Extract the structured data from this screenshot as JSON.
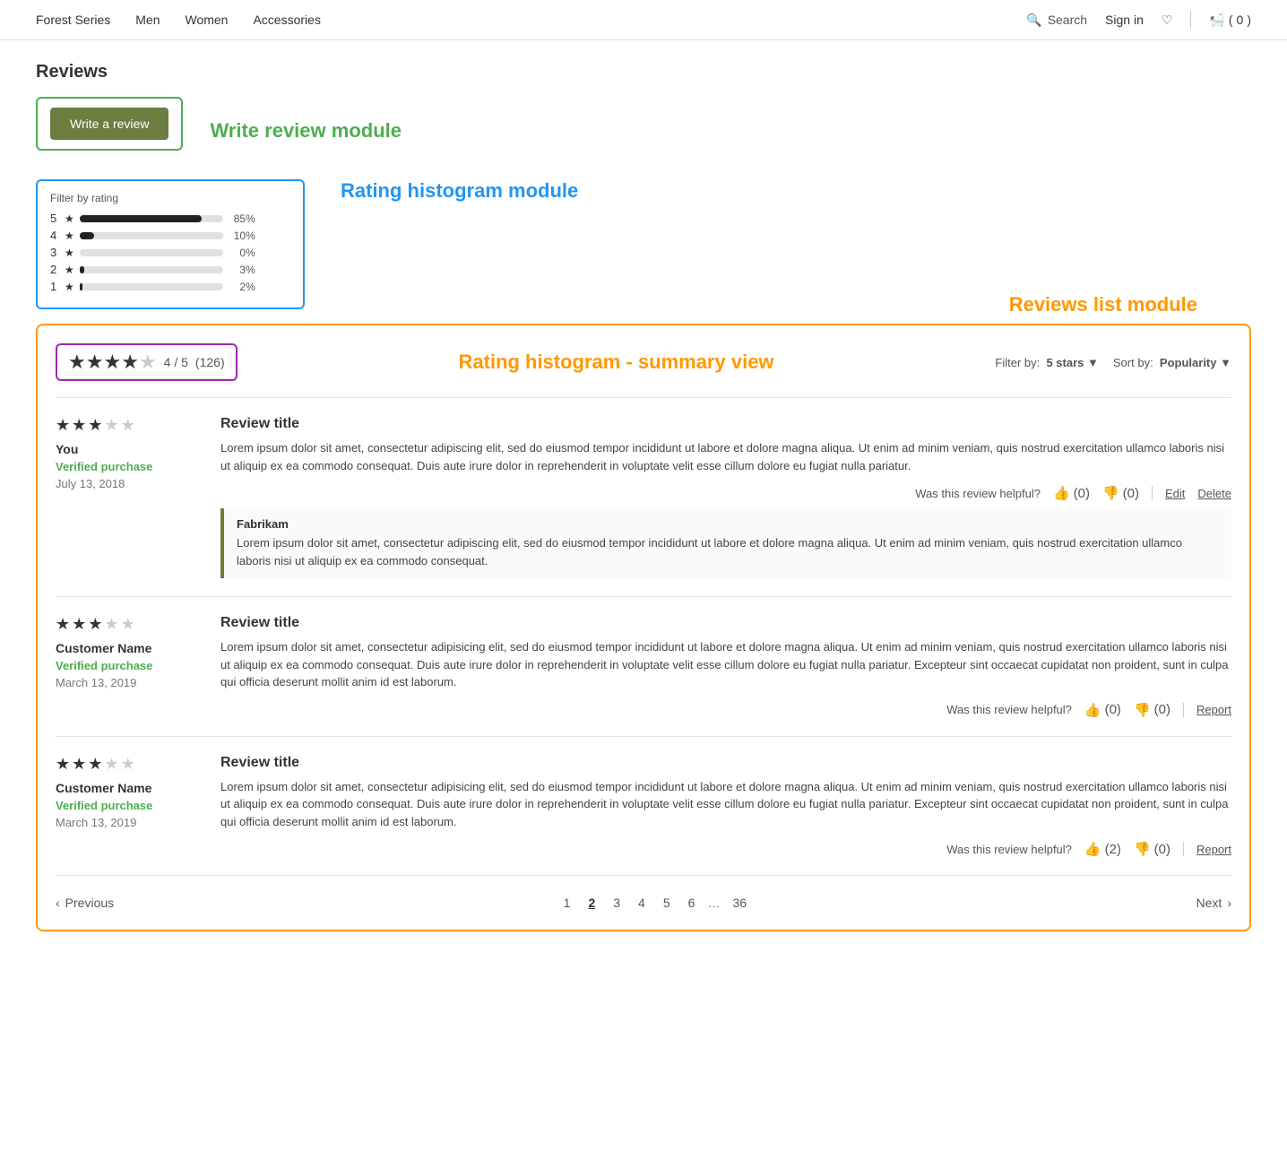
{
  "nav": {
    "links": [
      "Forest Series",
      "Men",
      "Women",
      "Accessories"
    ],
    "search_label": "Search",
    "signin_label": "Sign in",
    "cart_count": "0"
  },
  "page": {
    "title": "Reviews",
    "write_review_module_label": "Write review module",
    "write_review_btn": "Write a review",
    "histogram_module_label": "Rating histogram module",
    "histogram": {
      "title": "Filter by rating",
      "rows": [
        {
          "num": "5",
          "pct": 85,
          "pct_label": "85%"
        },
        {
          "num": "4",
          "pct": 10,
          "pct_label": "10%"
        },
        {
          "num": "3",
          "pct": 0,
          "pct_label": "0%"
        },
        {
          "num": "2",
          "pct": 3,
          "pct_label": "3%"
        },
        {
          "num": "1",
          "pct": 2,
          "pct_label": "2%"
        }
      ]
    },
    "reviews_list_label": "Reviews list module",
    "summary": {
      "stars": 4,
      "max": 5,
      "count": "(126)",
      "score": "4 / 5",
      "module_label": "Rating histogram - summary view",
      "filter_by_label": "Filter by:",
      "filter_value": "5 stars",
      "sort_by_label": "Sort by:",
      "sort_value": "Popularity"
    },
    "reviews": [
      {
        "stars": 3,
        "reviewer": "You",
        "verified": "Verified purchase",
        "date": "July 13, 2018",
        "title": "Review title",
        "body": "Lorem ipsum dolor sit amet, consectetur adipiscing elit, sed do eiusmod tempor incididunt ut labore et dolore magna aliqua. Ut enim ad minim veniam, quis nostrud exercitation ullamco laboris nisi ut aliquip ex ea commodo consequat. Duis aute irure dolor in reprehenderit in voluptate velit esse cillum dolore eu fugiat nulla pariatur.",
        "helpful_label": "Was this review helpful?",
        "up_count": "(0)",
        "down_count": "(0)",
        "actions": [
          "Edit",
          "Delete"
        ],
        "response": {
          "name": "Fabrikam",
          "body": "Lorem ipsum dolor sit amet, consectetur adipiscing elit, sed do eiusmod tempor incididunt ut labore et dolore magna aliqua. Ut enim ad minim veniam, quis nostrud exercitation ullamco laboris nisi ut aliquip ex ea commodo consequat."
        }
      },
      {
        "stars": 3,
        "reviewer": "Customer Name",
        "verified": "Verified purchase",
        "date": "March 13, 2019",
        "title": "Review title",
        "body": "Lorem ipsum dolor sit amet, consectetur adipisicing elit, sed do eiusmod tempor incididunt ut labore et dolore magna aliqua. Ut enim ad minim veniam, quis nostrud exercitation ullamco laboris nisi ut aliquip ex ea commodo consequat. Duis aute irure dolor in reprehenderit in voluptate velit esse cillum dolore eu fugiat nulla pariatur. Excepteur sint occaecat cupidatat non proident, sunt in culpa qui officia deserunt mollit anim id est laborum.",
        "helpful_label": "Was this review helpful?",
        "up_count": "(0)",
        "down_count": "(0)",
        "actions": [
          "Report"
        ],
        "response": null
      },
      {
        "stars": 3,
        "reviewer": "Customer Name",
        "verified": "Verified purchase",
        "date": "March 13, 2019",
        "title": "Review title",
        "body": "Lorem ipsum dolor sit amet, consectetur adipisicing elit, sed do eiusmod tempor incididunt ut labore et dolore magna aliqua. Ut enim ad minim veniam, quis nostrud exercitation ullamco laboris nisi ut aliquip ex ea commodo consequat. Duis aute irure dolor in reprehenderit in voluptate velit esse cillum dolore eu fugiat nulla pariatur. Excepteur sint occaecat cupidatat non proident, sunt in culpa qui officia deserunt mollit anim id est laborum.",
        "helpful_label": "Was this review helpful?",
        "up_count": "(2)",
        "down_count": "(0)",
        "actions": [
          "Report"
        ],
        "response": null
      }
    ],
    "pagination": {
      "prev_label": "Previous",
      "next_label": "Next",
      "pages": [
        "1",
        "2",
        "3",
        "4",
        "5",
        "6"
      ],
      "active_page": "2",
      "ellipsis": "…",
      "last_page": "36"
    }
  }
}
